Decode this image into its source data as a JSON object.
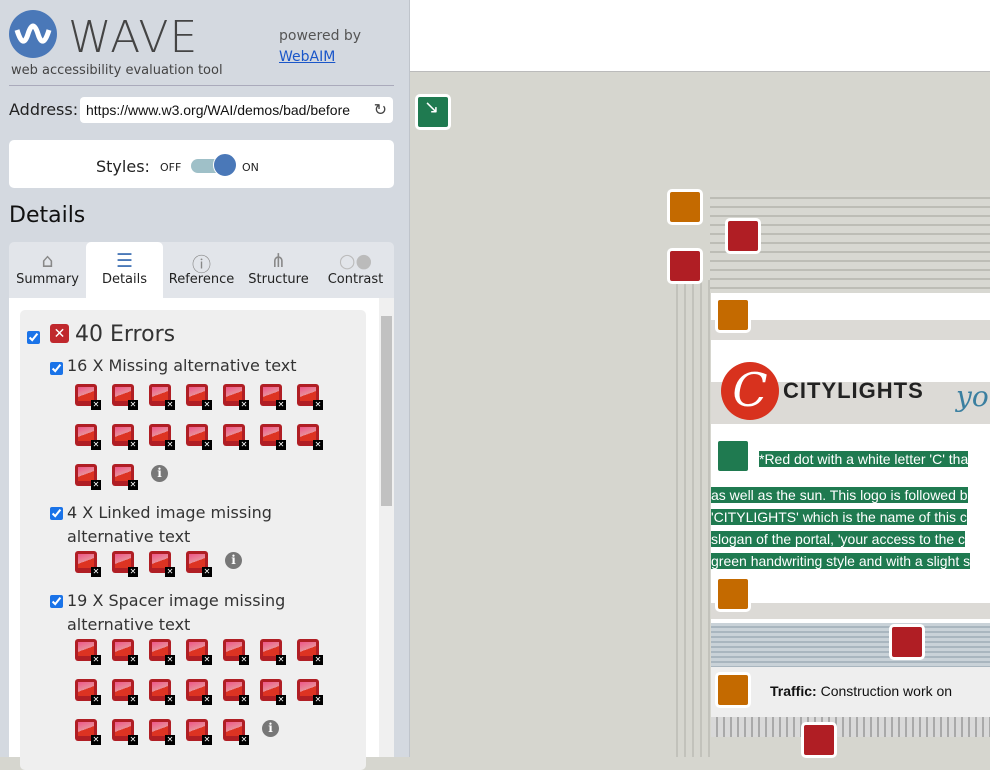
{
  "header": {
    "title": "WAVE",
    "tagline": "web accessibility evaluation tool",
    "powered_by": "powered by",
    "webaim_link": "WebAIM"
  },
  "address": {
    "label": "Address:",
    "value": "https://www.w3.org/WAI/demos/bad/before"
  },
  "styles": {
    "label": "Styles:",
    "off": "OFF",
    "on": "ON",
    "state": "on"
  },
  "details_heading": "Details",
  "tabs": [
    {
      "label": "Summary",
      "icon": "home-icon"
    },
    {
      "label": "Details",
      "icon": "list-icon",
      "active": true
    },
    {
      "label": "Reference",
      "icon": "info-icon"
    },
    {
      "label": "Structure",
      "icon": "structure-icon"
    },
    {
      "label": "Contrast",
      "icon": "contrast-icon"
    }
  ],
  "errors": {
    "title": "40 Errors",
    "groups": [
      {
        "label": "16 X Missing alternative text",
        "count": 16
      },
      {
        "label": "4 X Linked image missing alternative text",
        "count": 4
      },
      {
        "label": "19 X Spacer image missing alternative text",
        "count": 19
      }
    ]
  },
  "page": {
    "alt_text": [
      "*Red dot with a white letter 'C' tha",
      "as well as the sun. This logo is followed b",
      "'CITYLIGHTS' which is the name of this c",
      "slogan of the portal, 'your access to the c",
      "green handwriting style and with a slight s"
    ],
    "logo_text": "CITYLIGHTS",
    "slogan_fragment": "you",
    "traffic_label": "Traffic:",
    "traffic_text": "Construction work on"
  },
  "colors": {
    "error": "#b01e24",
    "alert": "#c46a00",
    "feature": "#1f7a50",
    "accent": "#4a78b8"
  }
}
